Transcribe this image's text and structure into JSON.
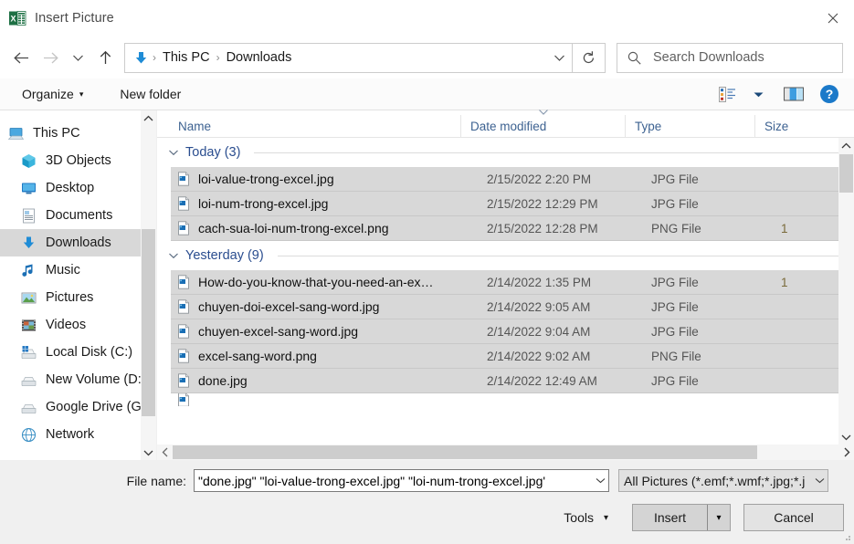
{
  "window": {
    "title": "Insert Picture",
    "app_icon": "excel-icon",
    "close_label": "✕"
  },
  "nav": {
    "back_icon": "arrow-left-icon",
    "forward_icon": "arrow-right-icon",
    "recent_icon": "chevron-down-icon",
    "up_icon": "arrow-up-icon",
    "address_icon": "downloads-arrow-icon",
    "breadcrumbs": [
      "This PC",
      "Downloads"
    ],
    "separator": "›",
    "dropdown_icon": "chevron-down-icon",
    "refresh_icon": "refresh-icon",
    "search_icon": "search-icon",
    "search_placeholder": "Search Downloads"
  },
  "commandbar": {
    "organize_label": "Organize",
    "organize_caret": "▾",
    "new_folder_label": "New folder",
    "view_icon": "list-view-icon",
    "view_caret": "▾",
    "pane_icon": "preview-pane-icon",
    "help_icon": "help-icon"
  },
  "sidebar": {
    "scroll_up_icon": "chevron-up-icon",
    "scroll_down_icon": "chevron-down-icon",
    "items": [
      {
        "label": "This PC",
        "icon": "computer-icon",
        "selected": false,
        "root": true
      },
      {
        "label": "3D Objects",
        "icon": "cube-icon",
        "selected": false,
        "root": false
      },
      {
        "label": "Desktop",
        "icon": "desktop-icon",
        "selected": false,
        "root": false
      },
      {
        "label": "Documents",
        "icon": "documents-icon",
        "selected": false,
        "root": false
      },
      {
        "label": "Downloads",
        "icon": "downloads-icon",
        "selected": true,
        "root": false
      },
      {
        "label": "Music",
        "icon": "music-icon",
        "selected": false,
        "root": false
      },
      {
        "label": "Pictures",
        "icon": "pictures-icon",
        "selected": false,
        "root": false
      },
      {
        "label": "Videos",
        "icon": "videos-icon",
        "selected": false,
        "root": false
      },
      {
        "label": "Local Disk (C:)",
        "icon": "local-disk-icon",
        "selected": false,
        "root": false
      },
      {
        "label": "New Volume (D:)",
        "icon": "drive-icon",
        "selected": false,
        "root": false
      },
      {
        "label": "Google Drive (G:)",
        "icon": "drive-icon",
        "selected": false,
        "root": false
      },
      {
        "label": "Network",
        "icon": "network-icon",
        "selected": false,
        "root": false
      }
    ]
  },
  "filelist": {
    "columns": [
      {
        "label": "Name",
        "sorted": false
      },
      {
        "label": "Date modified",
        "sorted": true
      },
      {
        "label": "Type",
        "sorted": false
      },
      {
        "label": "Size",
        "sorted": false
      }
    ],
    "sort_icon": "chevron-down-icon",
    "collapse_icon": "chevron-down-icon",
    "groups": [
      {
        "label": "Today (3)",
        "rows": [
          {
            "name": "loi-value-trong-excel.jpg",
            "date": "2/15/2022 2:20 PM",
            "type": "JPG File",
            "size": "",
            "selected": true
          },
          {
            "name": "loi-num-trong-excel.jpg",
            "date": "2/15/2022 12:29 PM",
            "type": "JPG File",
            "size": "",
            "selected": true
          },
          {
            "name": "cach-sua-loi-num-trong-excel.png",
            "date": "2/15/2022 12:28 PM",
            "type": "PNG File",
            "size": "1",
            "selected": true
          }
        ]
      },
      {
        "label": "Yesterday (9)",
        "rows": [
          {
            "name": "How-do-you-know-that-you-need-an-ex…",
            "date": "2/14/2022 1:35 PM",
            "type": "JPG File",
            "size": "1",
            "selected": true
          },
          {
            "name": "chuyen-doi-excel-sang-word.jpg",
            "date": "2/14/2022 9:05 AM",
            "type": "JPG File",
            "size": "",
            "selected": true
          },
          {
            "name": "chuyen-excel-sang-word.jpg",
            "date": "2/14/2022 9:04 AM",
            "type": "JPG File",
            "size": "",
            "selected": true
          },
          {
            "name": "excel-sang-word.png",
            "date": "2/14/2022 9:02 AM",
            "type": "PNG File",
            "size": "",
            "selected": true
          },
          {
            "name": "done.jpg",
            "date": "2/14/2022 12:49 AM",
            "type": "JPG File",
            "size": "",
            "selected": true
          }
        ]
      }
    ],
    "scroll_up_icon": "chevron-up-icon",
    "scroll_down_icon": "chevron-down-icon",
    "scroll_left_icon": "chevron-left-icon",
    "scroll_right_icon": "chevron-right-icon"
  },
  "footer": {
    "filename_label": "File name:",
    "filename_value": "\"done.jpg\" \"loi-value-trong-excel.jpg\" \"loi-num-trong-excel.jpg'",
    "filename_chevron": "chevron-down-icon",
    "filetype_value": "All Pictures (*.emf;*.wmf;*.jpg;*.j",
    "filetype_chevron": "chevron-down-icon",
    "tools_label": "Tools",
    "tools_caret": "▾",
    "insert_label": "Insert",
    "insert_caret": "▾",
    "cancel_label": "Cancel"
  },
  "colors": {
    "accent_blue": "#0078d7",
    "group_header": "#2a4d8f",
    "column_header": "#3d6291",
    "selection": "#d8d8d8",
    "footer_bg": "#f0f0f0"
  }
}
